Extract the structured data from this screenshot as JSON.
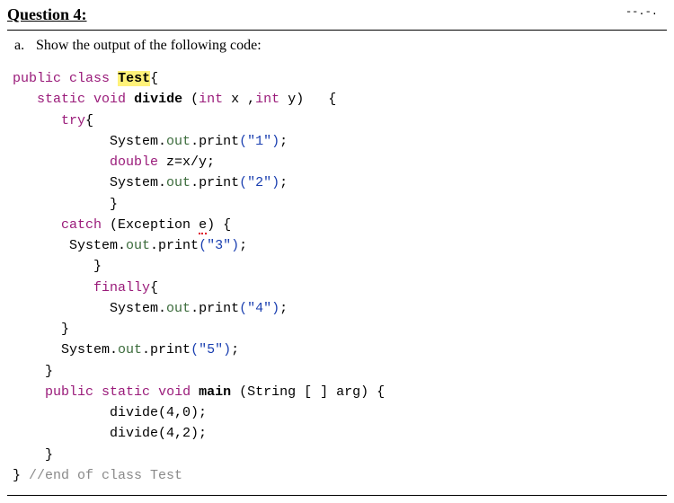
{
  "question": {
    "heading": "Question 4:",
    "sub_letter": "a.",
    "sub_text": "Show the output of the following code:"
  },
  "kw": {
    "public": "public",
    "class": "class",
    "static": "static",
    "void": "void",
    "int": "int",
    "try": "try",
    "double": "double",
    "catch": "catch",
    "finally": "finally"
  },
  "code": {
    "class_name": "Test",
    "method1": "divide",
    "param_x": "x",
    "param_y": "y",
    "out": "out",
    "system": "System.",
    "print": ".print",
    "str1": "(\"1\")",
    "str2": "(\"2\")",
    "str3": "(\"3\")",
    "str4": "(\"4\")",
    "str5": "(\"5\")",
    "z_decl": " z=x/y;",
    "exception": "(Exception ",
    "e_var": "e",
    "exception_close": ") {",
    "main": "main",
    "main_args": " (String [ ] arg) {",
    "call1": "divide(4,0);",
    "call2": "divide(4,2);",
    "end_comment": "//end of class Test"
  },
  "punct": {
    "space_open_brace": " {",
    "open_brace": "{",
    "close_brace": "}",
    "semicolon": ";",
    "method_sig_open": " (",
    "comma_space": " ,",
    "close_paren_space": ")   "
  },
  "top_right": "--.-."
}
